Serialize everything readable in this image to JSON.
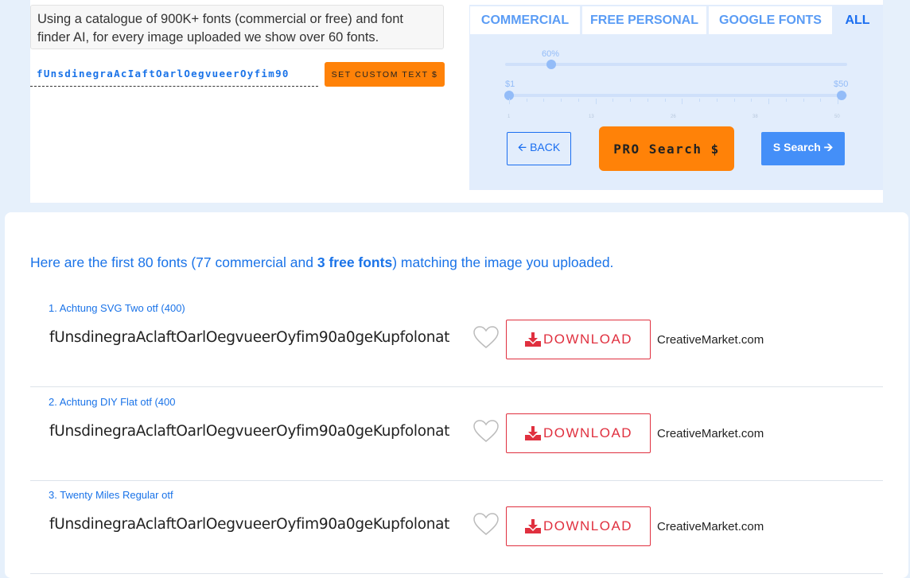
{
  "intro": {
    "description": "Using a catalogue of 900K+ fonts (commercial or free) and font finder AI, for every image uploaded we show over 60 fonts.",
    "custom_text": "fUnsdinegraAcIaftOarlOegvueerOyfim90",
    "set_custom_label": "SET CUSTOM TEXT $"
  },
  "filters": {
    "tabs": [
      {
        "label": "COMMERCIAL"
      },
      {
        "label": "FREE PERSONAL"
      },
      {
        "label": "GOOGLE FONTS"
      },
      {
        "label": "ALL",
        "active": true
      }
    ],
    "similarity": {
      "value_label": "60%",
      "value": 60
    },
    "price": {
      "min_label": "$1",
      "max_label": "$50",
      "min": 1,
      "max": 50,
      "ticks": [
        "1",
        "13",
        "26",
        "38",
        "50"
      ]
    },
    "back_label": "BACK",
    "pro_label": "PRO Search $",
    "s_search_label": "S Search"
  },
  "results": {
    "headline_pre": "Here are the first 80 fonts (77 commercial and ",
    "headline_bold": "3 free fonts",
    "headline_post": ") matching the image you uploaded.",
    "download_label": "DOWNLOAD",
    "items": [
      {
        "name": "1. Achtung SVG Two otf (400)",
        "sample": "fUnsdinegraAclaftOarlOegvueerOyfim90a0geKupfolonat",
        "site": "CreativeMarket.com"
      },
      {
        "name": "2. Achtung DIY Flat otf (400",
        "sample": "fUnsdinegraAclaftOarlOegvueerOyfim90a0geKupfolonat",
        "site": "CreativeMarket.com"
      },
      {
        "name": "3. Twenty Miles Regular otf",
        "sample": "fUnsdinegraAclaftOarlOegvueerOyfim90a0geKupfolonat",
        "site": "CreativeMarket.com"
      }
    ]
  },
  "colors": {
    "accent": "#1a73e8",
    "orange": "#ff8208",
    "download_red": "#e0303f"
  }
}
